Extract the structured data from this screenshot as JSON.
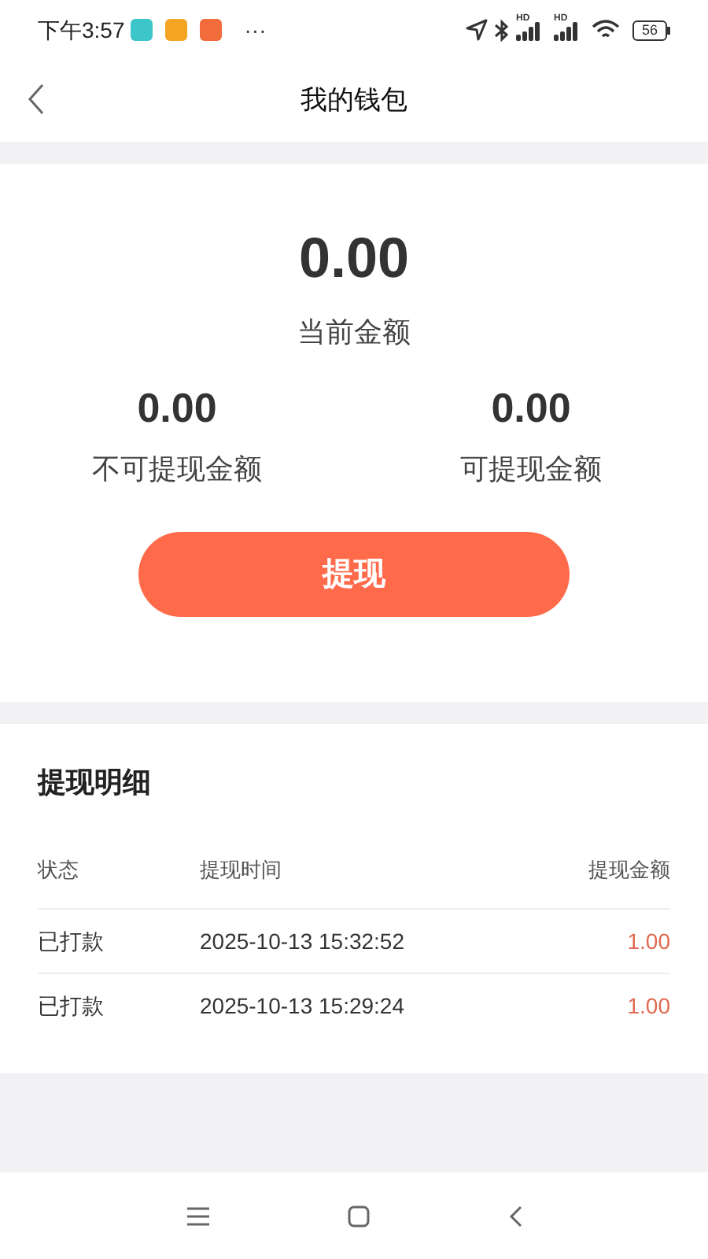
{
  "status_bar": {
    "time": "下午3:57",
    "app_icons": [
      {
        "color": "#3cc6c9"
      },
      {
        "color": "#f5a524"
      },
      {
        "color": "#f26b3a"
      }
    ],
    "more": "···",
    "signals": [
      {
        "label": "HD"
      },
      {
        "label": "HD"
      }
    ],
    "battery": "56"
  },
  "header": {
    "title": "我的钱包"
  },
  "balance": {
    "amount": "0.00",
    "label": "当前金额"
  },
  "sub_balances": [
    {
      "amount": "0.00",
      "label": "不可提现金额"
    },
    {
      "amount": "0.00",
      "label": "可提现金额"
    }
  ],
  "withdraw_button": "提现",
  "details": {
    "title": "提现明细",
    "columns": [
      "状态",
      "提现时间",
      "提现金额"
    ],
    "rows": [
      {
        "status": "已打款",
        "time": "2025-10-13 15:32:52",
        "amount": "1.00"
      },
      {
        "status": "已打款",
        "time": "2025-10-13 15:29:24",
        "amount": "1.00"
      }
    ]
  }
}
